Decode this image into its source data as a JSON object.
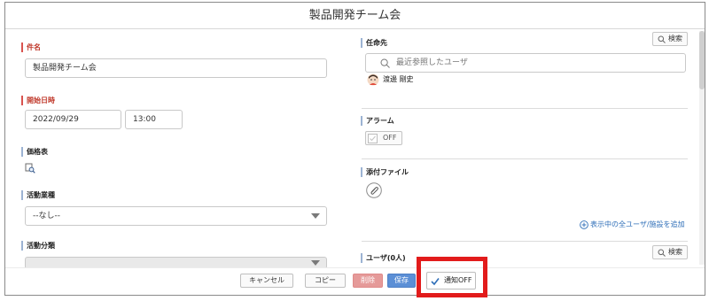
{
  "window": {
    "title": "製品開発チーム会"
  },
  "left": {
    "subject_label": "件名",
    "subject_value": "製品開発チーム会",
    "start_label": "開始日時",
    "start_date": "2022/09/29",
    "start_time": "13:00",
    "price_list_label": "価格表",
    "activity_type_label": "活動業種",
    "activity_type_value": "--なし--",
    "activity_category_label": "活動分類"
  },
  "right": {
    "assignee_label": "任命先",
    "assignee_search_button": "検索",
    "recent_search_placeholder": "最近参照したユーザ",
    "assigned_user": "渡邊 剛史",
    "alarm_label": "アラーム",
    "alarm_value": "OFF",
    "attachment_label": "添付ファイル",
    "add_all_link": "表示中の全ユーザ/施設を追加",
    "users_label": "ユーザ(0人)",
    "users_search_button": "検索"
  },
  "footer": {
    "cancel": "キャンセル",
    "copy": "コピー",
    "delete": "削除",
    "save": "保存",
    "notify": "通知OFF"
  },
  "colors": {
    "required": "#c0392b",
    "accent_border": "#9cb3d3",
    "delete_button": "#e59a99",
    "save_button": "#5b8fd6",
    "highlight": "#e21b1b"
  }
}
